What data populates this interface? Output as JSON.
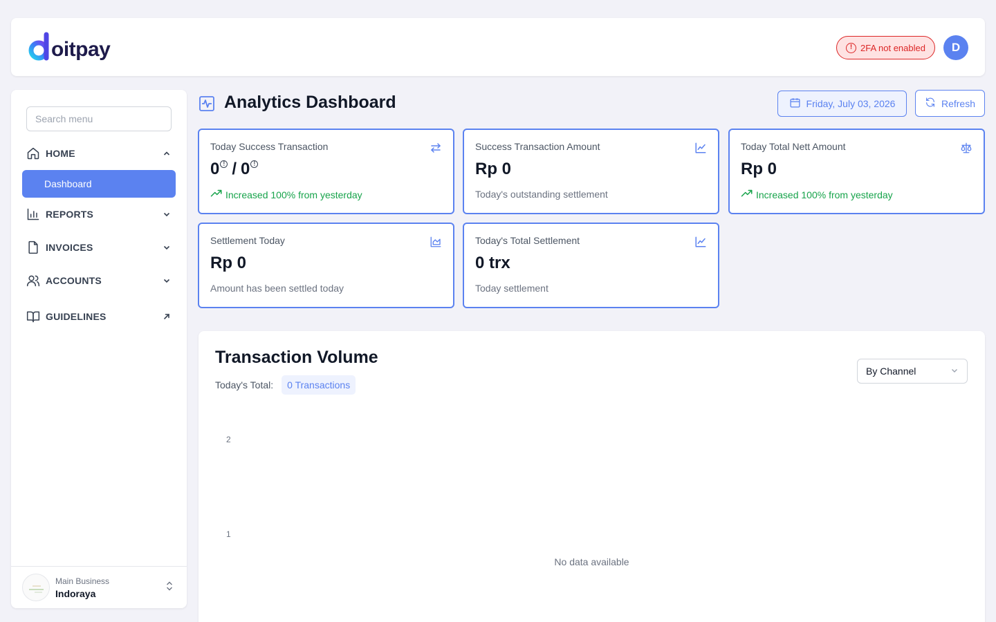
{
  "header": {
    "logo_text": "oitpay",
    "twofa_label": "2FA not enabled",
    "avatar_initial": "D"
  },
  "sidebar": {
    "search_placeholder": "Search menu",
    "items": [
      {
        "label": "HOME",
        "icon": "home-icon",
        "chevron": "up"
      },
      {
        "label": "REPORTS",
        "icon": "bar-chart-icon",
        "chevron": "down"
      },
      {
        "label": "INVOICES",
        "icon": "document-icon",
        "chevron": "down"
      },
      {
        "label": "ACCOUNTS",
        "icon": "users-icon",
        "chevron": "down"
      },
      {
        "label": "GUIDELINES",
        "icon": "book-icon",
        "chevron": "external"
      }
    ],
    "active_sub": "Dashboard",
    "business": {
      "sub": "Main Business",
      "name": "Indoraya"
    }
  },
  "main": {
    "title": "Analytics Dashboard",
    "date_label": "Friday, July 03, 2026",
    "refresh_label": "Refresh",
    "cards": [
      {
        "title": "Today Success Transaction",
        "value_a": "0",
        "value_b": "0",
        "note": "Increased 100% from yesterday",
        "note_trend": "up",
        "icon": "swap-icon"
      },
      {
        "title": "Success Transaction Amount",
        "value": "Rp 0",
        "note": "Today's outstanding settlement",
        "icon": "line-chart-icon"
      },
      {
        "title": "Today Total Nett Amount",
        "value": "Rp 0",
        "note": "Increased 100% from yesterday",
        "note_trend": "up",
        "icon": "scale-icon"
      },
      {
        "title": "Settlement Today",
        "value": "Rp 0",
        "note": "Amount has been settled today",
        "icon": "area-chart-icon"
      },
      {
        "title": "Today's Total Settlement",
        "value": "0 trx",
        "note": "Today settlement",
        "icon": "line-chart-icon"
      }
    ]
  },
  "volume": {
    "title": "Transaction Volume",
    "total_label": "Today's Total:",
    "total_value": "0 Transactions",
    "filter_value": "By Channel",
    "y_ticks": [
      "2",
      "1"
    ],
    "empty_text": "No data available"
  },
  "colors": {
    "accent": "#5b82f0",
    "danger": "#dc2626",
    "success": "#16a34a"
  }
}
